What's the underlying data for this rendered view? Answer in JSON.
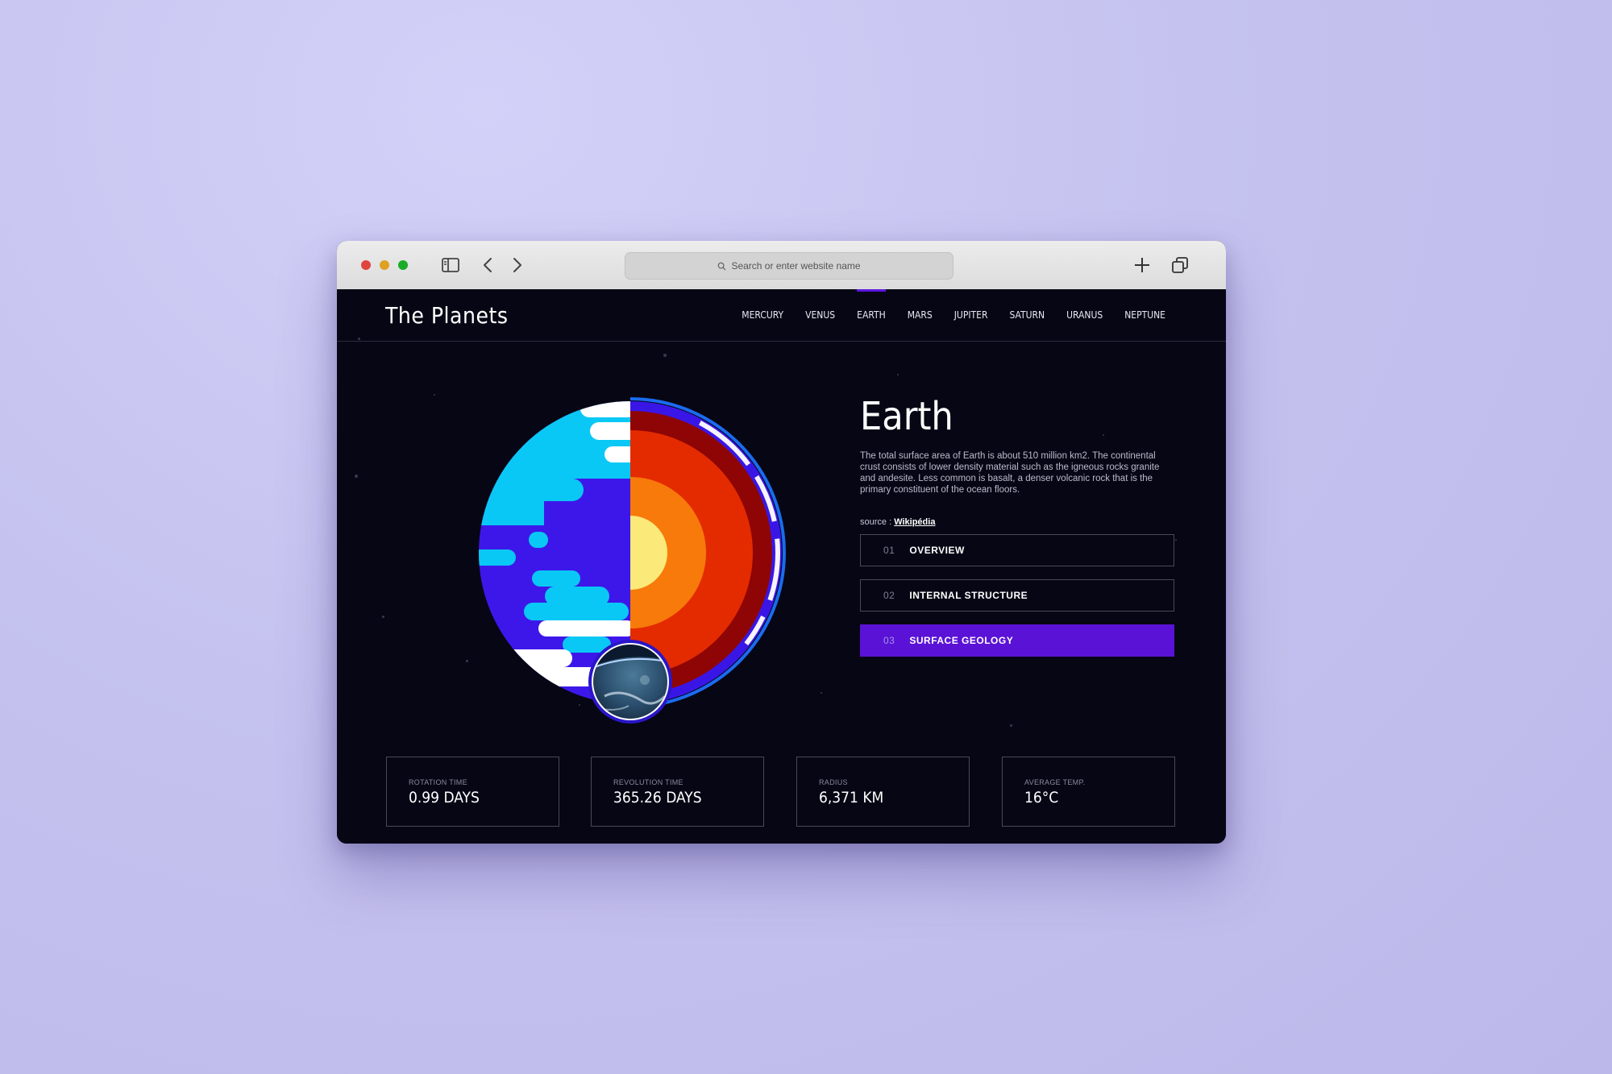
{
  "browser": {
    "address_placeholder": "Search or enter website name",
    "icons": [
      "sidebar-toggle-icon",
      "back-chevron-icon",
      "forward-chevron-icon",
      "search-icon",
      "new-tab-plus-icon",
      "tabs-overview-icon"
    ]
  },
  "site": {
    "logo": "The Planets",
    "nav": [
      "MERCURY",
      "VENUS",
      "EARTH",
      "MARS",
      "JUPITER",
      "SATURN",
      "URANUS",
      "NEPTUNE"
    ],
    "active_nav": "EARTH"
  },
  "planet": {
    "name": "Earth",
    "description": "The total surface area of Earth is about 510 million km2. The continental crust consists of lower density material such as the igneous rocks granite and andesite. Less common is basalt, a denser volcanic rock that is the primary constituent of the ocean floors.",
    "source_label": "source : ",
    "source_link": "Wikipédia"
  },
  "tabs": [
    {
      "num": "01",
      "label": "OVERVIEW",
      "active": false
    },
    {
      "num": "02",
      "label": "INTERNAL STRUCTURE",
      "active": false
    },
    {
      "num": "03",
      "label": "SURFACE GEOLOGY",
      "active": true
    }
  ],
  "stats": [
    {
      "label": "ROTATION TIME",
      "value": "0.99 DAYS"
    },
    {
      "label": "REVOLUTION TIME",
      "value": "365.26 DAYS"
    },
    {
      "label": "RADIUS",
      "value": "6,371 KM"
    },
    {
      "label": "AVERAGE TEMP.",
      "value": "16°C"
    }
  ],
  "colors": {
    "accent": "#5a12d6",
    "background": "#070615",
    "page_bg": "#c5c2ef"
  }
}
